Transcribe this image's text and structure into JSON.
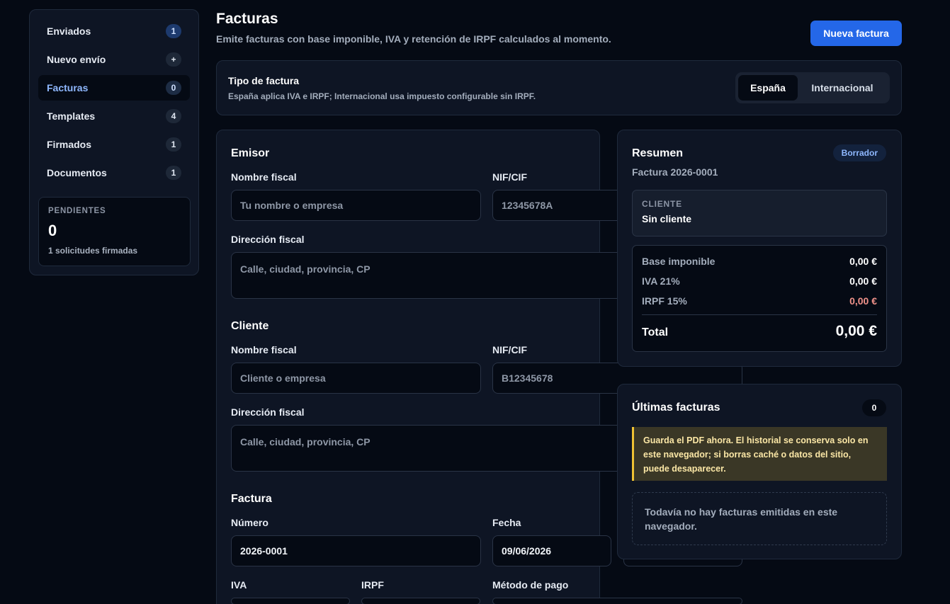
{
  "sidebar": {
    "items": [
      {
        "label": "Enviados",
        "badge": "1"
      },
      {
        "label": "Nuevo envío",
        "badge": "+"
      },
      {
        "label": "Facturas",
        "badge": "0"
      },
      {
        "label": "Templates",
        "badge": "4"
      },
      {
        "label": "Firmados",
        "badge": "1"
      },
      {
        "label": "Documentos",
        "badge": "1"
      }
    ],
    "active": "Facturas",
    "pending": {
      "label": "PENDIENTES",
      "count": "0",
      "sub": "1 solicitudes firmadas"
    }
  },
  "header": {
    "title": "Facturas",
    "subtitle": "Emite facturas con base imponible, IVA y retención de IRPF calculados al momento.",
    "new_button": "Nueva factura"
  },
  "invoice_type": {
    "title": "Tipo de factura",
    "description": "España aplica IVA e IRPF; Internacional usa impuesto configurable sin IRPF.",
    "options": [
      "España",
      "Internacional"
    ],
    "selected": "España"
  },
  "form": {
    "emisor": {
      "title": "Emisor",
      "name_label": "Nombre fiscal",
      "name_placeholder": "Tu nombre o empresa",
      "nif_label": "NIF/CIF",
      "nif_placeholder": "12345678A",
      "address_label": "Dirección fiscal",
      "address_placeholder": "Calle, ciudad, provincia, CP"
    },
    "cliente": {
      "title": "Cliente",
      "name_label": "Nombre fiscal",
      "name_placeholder": "Cliente o empresa",
      "nif_label": "NIF/CIF",
      "nif_placeholder": "B12345678",
      "address_label": "Dirección fiscal",
      "address_placeholder": "Calle, ciudad, provincia, CP"
    },
    "factura": {
      "title": "Factura",
      "number_label": "Número",
      "number_value": "2026-0001",
      "date_label": "Fecha",
      "date_value": "09/06/2026",
      "iva_label": "IVA",
      "irpf_label": "IRPF",
      "payment_label": "Método de pago"
    }
  },
  "summary": {
    "title": "Resumen",
    "status": "Borrador",
    "invoice_number": "Factura 2026-0001",
    "client_label": "CLIENTE",
    "client_value": "Sin cliente",
    "rows": [
      {
        "label": "Base imponible",
        "value": "0,00 €"
      },
      {
        "label": "IVA 21%",
        "value": "0,00 €"
      },
      {
        "label": "IRPF 15%",
        "value": "0,00 €"
      }
    ],
    "total_label": "Total",
    "total_value": "0,00 €"
  },
  "latest": {
    "title": "Últimas facturas",
    "count": "0",
    "warning": "Guarda el PDF ahora. El historial se conserva solo en este navegador; si borras caché o datos del sitio, puede desaparecer.",
    "empty": "Todavía no hay facturas emitidas en este navegador."
  },
  "colors": {
    "background": "#050a14",
    "card": "#0e1524",
    "accent": "#2467e8",
    "active_nav_text": "#8fb8ff",
    "negative": "#f0928a",
    "warning_border": "#f0c233"
  }
}
